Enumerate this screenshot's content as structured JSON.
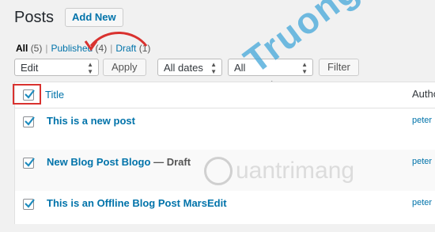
{
  "header": {
    "title": "Posts",
    "add_new": "Add New"
  },
  "filters": {
    "all_label": "All",
    "all_count": "(5)",
    "published_label": "Published",
    "published_count": "(4)",
    "draft_label": "Draft",
    "draft_count": "(1)"
  },
  "tablenav": {
    "bulk_action": "Edit",
    "apply": "Apply",
    "dates": "All dates",
    "categories": "All Categories",
    "filter": "Filter"
  },
  "table": {
    "columns": {
      "title": "Title",
      "author": "Author"
    },
    "rows": [
      {
        "title": "This is a new post",
        "state": "",
        "author": "peter",
        "checked": true
      },
      {
        "title": "New Blog Post Blogo",
        "state": "— Draft",
        "author": "peter",
        "checked": true
      },
      {
        "title": "This is an Offline Blog Post MarsEdit",
        "state": "",
        "author": "peter",
        "checked": true
      }
    ]
  },
  "watermark": {
    "brand": "Truongthinh.top",
    "logo": "uantrimang"
  },
  "colors": {
    "accent": "#0073aa",
    "highlight": "#d9322f"
  }
}
